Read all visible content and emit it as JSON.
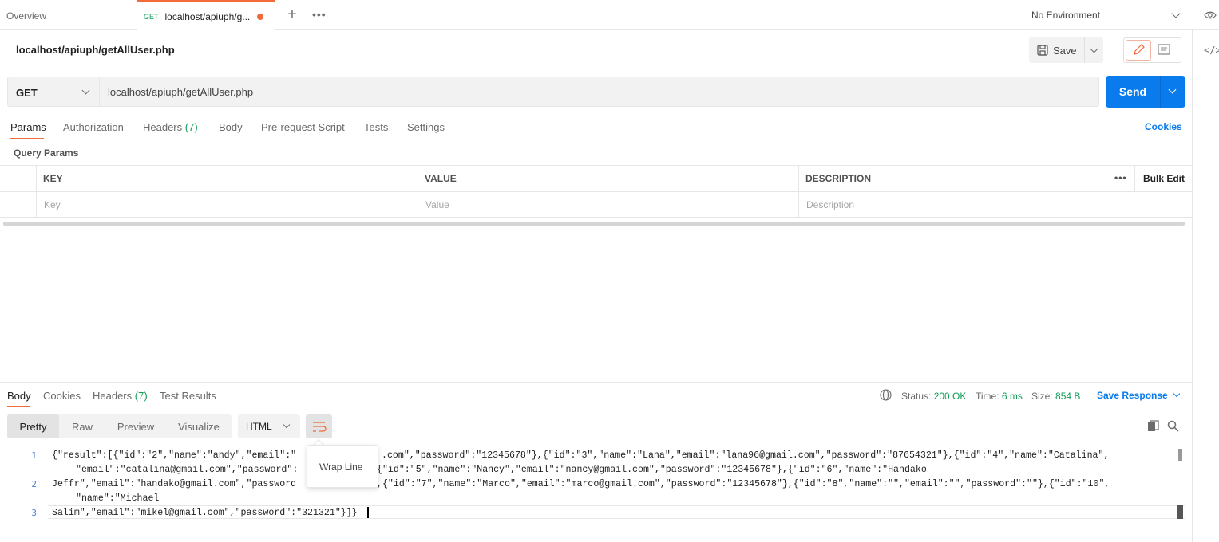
{
  "tabs": {
    "overview": "Overview",
    "active_method": "GET",
    "active_label": "localhost/apiuph/g...",
    "environment": "No Environment"
  },
  "request": {
    "title": "localhost/apiuph/getAllUser.php",
    "save_label": "Save",
    "method": "GET",
    "url": "localhost/apiuph/getAllUser.php",
    "send_label": "Send"
  },
  "request_tabs": {
    "params": "Params",
    "authorization": "Authorization",
    "headers": "Headers",
    "headers_count": "(7)",
    "body": "Body",
    "pre_request": "Pre-request Script",
    "tests": "Tests",
    "settings": "Settings",
    "cookies": "Cookies"
  },
  "query_params": {
    "label": "Query Params",
    "col_key": "KEY",
    "col_value": "VALUE",
    "col_description": "DESCRIPTION",
    "bulk_edit": "Bulk Edit",
    "more": "•••",
    "key_placeholder": "Key",
    "value_placeholder": "Value",
    "description_placeholder": "Description"
  },
  "response_tabs": {
    "body": "Body",
    "cookies": "Cookies",
    "headers": "Headers",
    "headers_count": "(7)",
    "test_results": "Test Results"
  },
  "response_meta": {
    "status_label": "Status:",
    "status_value": "200 OK",
    "time_label": "Time:",
    "time_value": "6 ms",
    "size_label": "Size:",
    "size_value": "854 B",
    "save_response": "Save Response"
  },
  "body_view": {
    "pretty": "Pretty",
    "raw": "Raw",
    "preview": "Preview",
    "visualize": "Visualize",
    "language": "HTML",
    "wrap_tooltip": "Wrap Line"
  },
  "code_lines": {
    "l1": "1",
    "l2": "2",
    "l3": "3",
    "line1a": "{\"result\":[{\"id\":\"2\",\"name\":\"andy\",\"email\":\"",
    "line1a_tail": ".com\",\"password\":\"12345678\"},{\"id\":\"3\",\"name\":\"Lana\",\"email\":\"lana96@gmail.com\",\"password\":\"87654321\"},{\"id\":\"4\",\"name\":\"Catalina\",",
    "line1b": "\"email\":\"catalina@gmail.com\",\"password\":",
    "line1b_tail": "{\"id\":\"5\",\"name\":\"Nancy\",\"email\":\"nancy@gmail.com\",\"password\":\"12345678\"},{\"id\":\"6\",\"name\":\"Handako",
    "line2a": "Jeffr\",\"email\":\"handako@gmail.com\",\"password",
    "line2a_tail": ",{\"id\":\"7\",\"name\":\"Marco\",\"email\":\"marco@gmail.com\",\"password\":\"12345678\"},{\"id\":\"8\",\"name\":\"\",\"email\":\"\",\"password\":\"\"},{\"id\":\"10\",",
    "line2b": "\"name\":\"Michael",
    "line3": "Salim\",\"email\":\"mikel@gmail.com\",\"password\":\"321321\"}]}"
  }
}
